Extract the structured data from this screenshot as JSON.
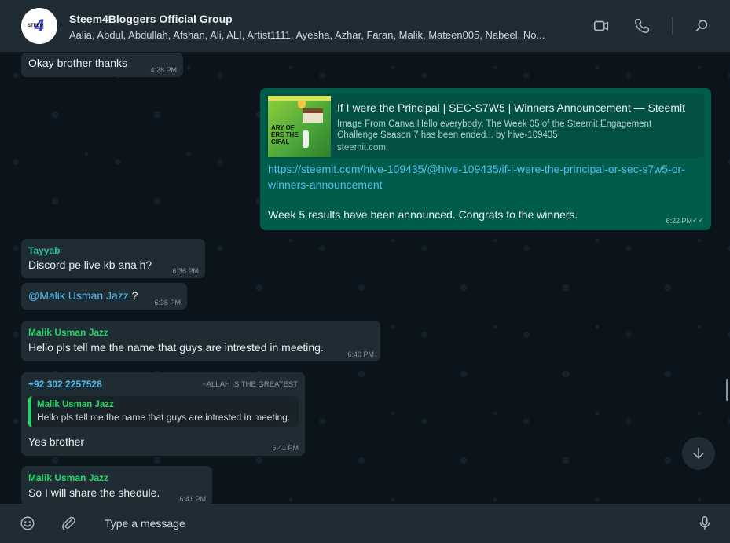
{
  "header": {
    "title": "Steem4Bloggers Official Group",
    "members": "Aalia, Abdul, Abdullah, Afshan, Ali, ALI, Artist1111, Ayesha, Azhar, Faran, Malik, Mateen005, Nabeel, No..."
  },
  "icons": {
    "video": "video-call-icon",
    "voice": "voice-call-icon",
    "search": "search-icon",
    "emoji": "emoji-icon",
    "attach": "paperclip-icon",
    "mic": "microphone-icon",
    "scroll": "chevron-down-icon"
  },
  "colors": {
    "incoming_bubble": "#202c33",
    "outgoing_bubble": "#005c4b",
    "background": "#0b141a",
    "accent_green": "#25d366",
    "link_blue": "#53bdeb"
  },
  "messages": {
    "m1": {
      "text": "Okay brother thanks",
      "time": "4:28 PM"
    },
    "m2": {
      "preview_title": "If I were the Principal | SEC-S7W5 | Winners Announcement — Steemit",
      "preview_desc": "Image From Canva      Hello everybody,   The Week 05 of the Steemit Engagement Challenge Season 7 has been ended... by hive-109435",
      "preview_domain": "steemit.com",
      "thumb_text": "ARY OF\nERE THE\nCIPAL",
      "link_line1": "https://steemit.com/hive-109435/@hive-109435/if-i-were-the-principal-or-sec-s7w5-or-",
      "link_line2": "winners-announcement",
      "text": "Week 5 results have been announced. Congrats to the winners.",
      "time": "6:22 PM",
      "status": "✓✓"
    },
    "m3": {
      "sender": "Tayyab",
      "text": "Discord pe live kb ana h?",
      "time": "6:36 PM"
    },
    "m4": {
      "mention": "@Malik Usman Jazz",
      "suffix": " ?",
      "time": "6:36 PM"
    },
    "m5": {
      "sender": "Malik Usman Jazz",
      "text": "Hello pls tell me the name that guys are intrested in meeting.",
      "time": "6:40 PM"
    },
    "m6": {
      "sender": "+92 302 2257528",
      "pushname": "~ALLAH IS THE GREATEST",
      "quote_name": "Malik Usman Jazz",
      "quote_text": "Hello pls tell me the name that guys are intrested in meeting.",
      "text": "Yes brother",
      "time": "6:41 PM"
    },
    "m7": {
      "sender": "Malik Usman Jazz",
      "text": "So I will share the shedule.",
      "time": "6:41 PM"
    }
  },
  "composer": {
    "placeholder": "Type a message"
  }
}
